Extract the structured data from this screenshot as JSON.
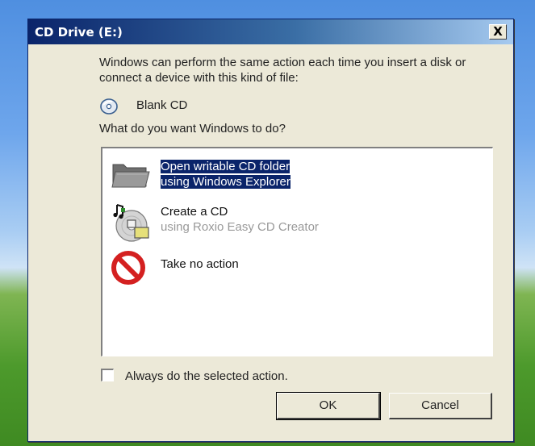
{
  "window": {
    "title": "CD Drive (E:)",
    "close_label": "X"
  },
  "intro_text": "Windows can perform the same action each time you insert a disk or connect a device with this kind of file:",
  "content_type": {
    "label": "Blank CD",
    "icon": "blank-cd-icon"
  },
  "question": "What do you want Windows to do?",
  "actions": [
    {
      "title": "Open writable CD folder",
      "subtitle": "using Windows Explorer",
      "icon": "folder-icon",
      "selected": true
    },
    {
      "title": "Create a CD",
      "subtitle": "using Roxio Easy CD Creator",
      "icon": "roxio-cd-icon",
      "selected": false
    },
    {
      "title": "Take no action",
      "subtitle": "",
      "icon": "no-action-icon",
      "selected": false
    }
  ],
  "always_checkbox": {
    "label": "Always do the selected action.",
    "checked": false
  },
  "buttons": {
    "ok": "OK",
    "cancel": "Cancel"
  },
  "colors": {
    "titlebar_dark": "#0a246a",
    "selection": "#0a246a",
    "dialog_bg": "#ece9d8"
  }
}
